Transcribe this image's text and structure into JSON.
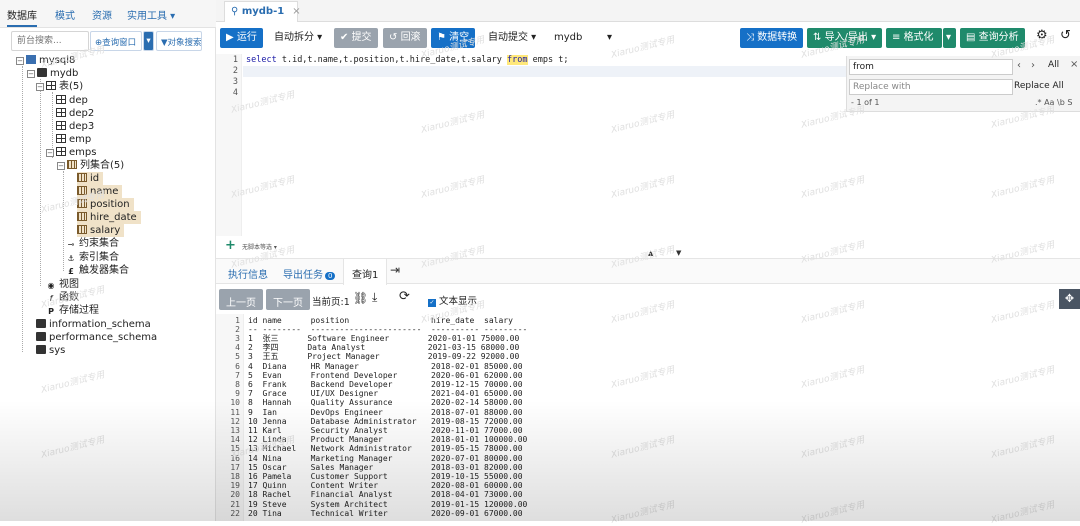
{
  "left_nav": {
    "tabs": [
      "数据库",
      "模式",
      "资源",
      "实用工具 ▾"
    ]
  },
  "left_search": {
    "placeholder": "前台搜索...",
    "locate_label": "查询窗口",
    "filter_label": "对象搜索"
  },
  "tree": {
    "server": "mysql8",
    "db": "mydb",
    "tables_group": "表(5)",
    "tables": [
      "dep",
      "dep2",
      "dep3",
      "emp",
      "emps"
    ],
    "columns_group": "列集合(5)",
    "columns": [
      "id",
      "name",
      "position",
      "hire_date",
      "salary"
    ],
    "constraints": "约束集合",
    "indexes": "索引集合",
    "triggers": "触发器集合",
    "views": "视图",
    "functions": "函数",
    "procedures": "存储过程",
    "other_dbs": [
      "information_schema",
      "performance_schema",
      "sys"
    ]
  },
  "tab": {
    "title": "mydb-1",
    "close": "×"
  },
  "toolbar": {
    "run": "运行",
    "auto_split": "自动拆分",
    "commit": "提交",
    "rollback": "回滚",
    "clear": "清空",
    "auto_commit": "自动提交",
    "db_select": "mydb",
    "convert": "数据转换",
    "import_export": "导入/导出",
    "format": "格式化",
    "analyze": "查询分析"
  },
  "editor": {
    "lines": [
      "1",
      "2",
      "3",
      "4"
    ],
    "code_kw1": "select",
    "code_mid": " t.id,t.name,t.position,t.hire_date,t.salary ",
    "code_kw2": "from",
    "code_tail": " emps t;"
  },
  "find": {
    "query": "from",
    "all": "All",
    "replace_placeholder": "Replace with",
    "replace_all": "Replace All",
    "count": "1 of 1",
    "options": ".* Aa \\b S"
  },
  "editor_footer": {
    "plus": "+",
    "label": "无脚本等选 ▾"
  },
  "results_tabs": {
    "exec": "执行信息",
    "export": "导出任务",
    "export_count": "0",
    "query": "查询1"
  },
  "results_toolbar": {
    "prev": "上一页",
    "next": "下一页",
    "current": "当前页:1",
    "text_view": "文本显示"
  },
  "grid": {
    "header": "id name      position                 hire_date  salary",
    "divider": "-- --------  -----------------------  ---------- ---------",
    "rows": [
      {
        "n": "3",
        "t": "1  张三      Software Engineer        2020-01-01 75000.00"
      },
      {
        "n": "4",
        "t": "2  李四      Data Analyst             2021-03-15 68000.00"
      },
      {
        "n": "5",
        "t": "3  王五      Project Manager          2019-09-22 92000.00"
      },
      {
        "n": "6",
        "t": "4  Diana     HR Manager               2018-02-01 85000.00"
      },
      {
        "n": "7",
        "t": "5  Evan      Frontend Developer       2020-06-01 62000.00"
      },
      {
        "n": "8",
        "t": "6  Frank     Backend Developer        2019-12-15 70000.00"
      },
      {
        "n": "9",
        "t": "7  Grace     UI/UX Designer           2021-04-01 65000.00"
      },
      {
        "n": "10",
        "t": "8  Hannah    Quality Assurance        2020-02-14 58000.00"
      },
      {
        "n": "11",
        "t": "9  Ian       DevOps Engineer          2018-07-01 88000.00"
      },
      {
        "n": "12",
        "t": "10 Jenna     Database Administrator   2019-08-15 72000.00"
      },
      {
        "n": "13",
        "t": "11 Karl      Security Analyst         2020-11-01 77000.00"
      },
      {
        "n": "14",
        "t": "12 Linda     Product Manager          2018-01-01 100000.00"
      },
      {
        "n": "15",
        "t": "13 Michael   Network Administrator    2019-05-15 78000.00"
      },
      {
        "n": "16",
        "t": "14 Nina      Marketing Manager        2020-07-01 80000.00"
      },
      {
        "n": "17",
        "t": "15 Oscar     Sales Manager            2018-03-01 82000.00"
      },
      {
        "n": "18",
        "t": "16 Pamela    Customer Support         2019-10-15 55000.00"
      },
      {
        "n": "19",
        "t": "17 Quinn     Content Writer           2020-08-01 60000.00"
      },
      {
        "n": "20",
        "t": "18 Rachel    Financial Analyst        2018-04-01 73000.00"
      },
      {
        "n": "21",
        "t": "19 Steve     System Architect         2019-01-15 120000.00"
      },
      {
        "n": "22",
        "t": "20 Tina      Technical Writer         2020-09-01 67000.00"
      }
    ]
  },
  "watermark": "Xiaruo测试专用",
  "colors": {
    "accent": "#1570c7",
    "selection": "#b9d3f0",
    "green": "#1f8a6b"
  }
}
